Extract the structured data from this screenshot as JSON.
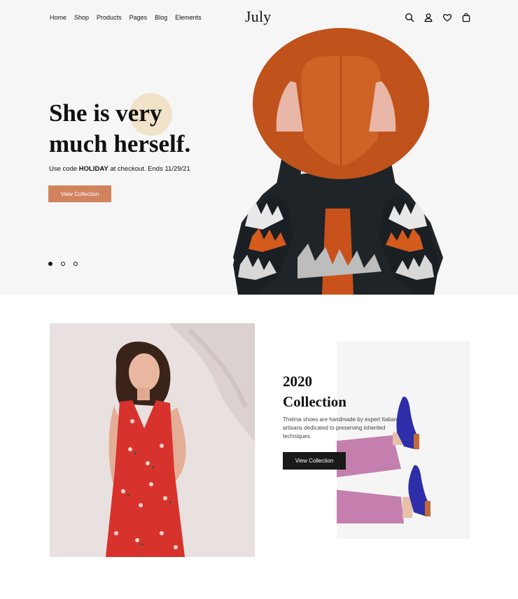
{
  "header": {
    "nav": [
      "Home",
      "Shop",
      "Products",
      "Pages",
      "Blog",
      "Elements"
    ],
    "brand": "July",
    "icons": [
      "search-icon",
      "user-icon",
      "heart-icon",
      "bag-icon"
    ]
  },
  "hero": {
    "title_line1": "She is very",
    "title_line2": "much herself.",
    "subtitle_prefix": "Use code",
    "subtitle_code": "HOLIDAY",
    "subtitle_suffix": "at checkout. Ends 11/29/21",
    "button_label": "View Collection",
    "slide_count": 3,
    "active_slide": 1
  },
  "collection": {
    "title_line1": "2020",
    "title_line2": "Collection",
    "description": "Thelma shoes are handmade by expert Italian artisans dedicated to preserving inherited techniques.",
    "button_label": "View Collection"
  },
  "colors": {
    "hero_bg": "#f6f6f6",
    "accent_button": "#d0835d",
    "accent_circle": "#f1e3c9",
    "dark_button": "#1a1a1a"
  }
}
